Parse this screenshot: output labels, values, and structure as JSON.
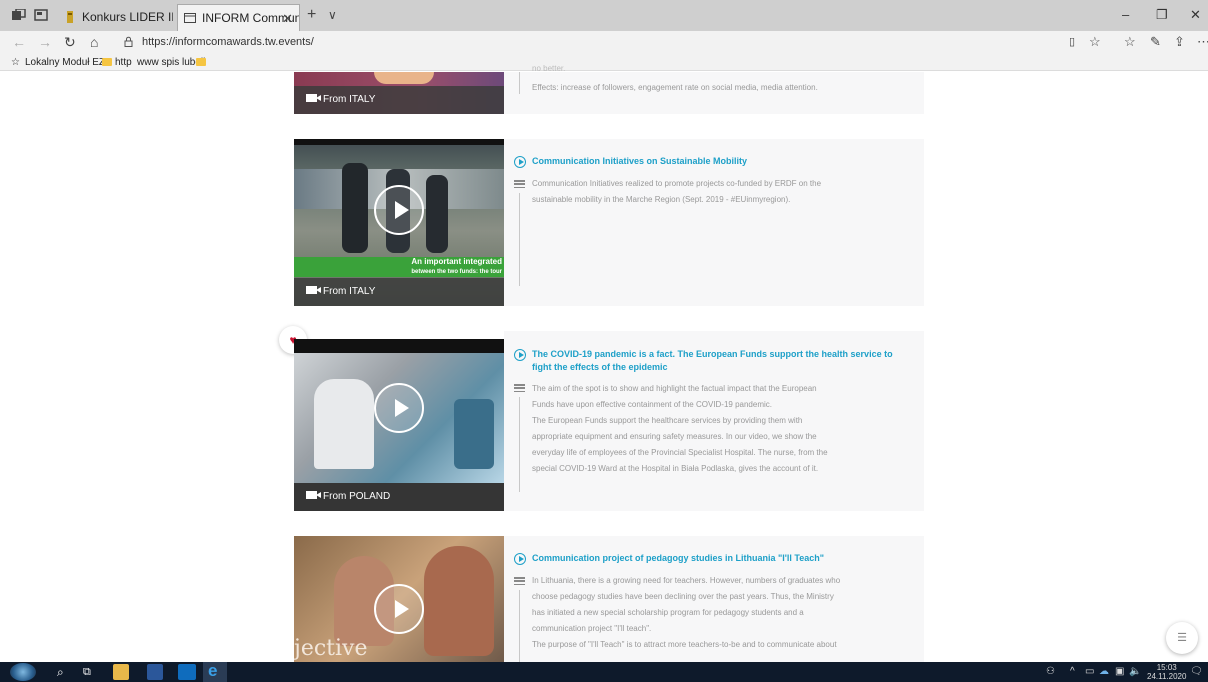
{
  "browser": {
    "tabs": [
      {
        "label": "Konkurs LIDER INNOWACJI",
        "active": false
      },
      {
        "label": "INFORM Communicatio",
        "active": true
      }
    ],
    "new_tab": "+",
    "tab_list": "∨",
    "url": "https://informcomawards.tw.events/",
    "bookmarks": [
      "Lokalny Moduł EZD",
      "http",
      "www spis lubeli"
    ]
  },
  "cards": [
    {
      "from": "From ITALY",
      "desc": [
        "no better.",
        "Effects: increase of followers, engagement rate on social media, media attention."
      ]
    },
    {
      "title": "Communication Initiatives on Sustainable Mobility",
      "from": "From ITALY",
      "overlay_text": [
        "An important integrated",
        "between the two funds: the tour"
      ],
      "desc": [
        "Communication Initiatives realized to promote projects co-funded by ERDF on the",
        "sustainable mobility in the Marche Region (Sept. 2019 - #EUinmyregion)."
      ]
    },
    {
      "title_lines": [
        "The COVID-19 pandemic is a fact. The European Funds support the health service to",
        "fight the effects of the epidemic"
      ],
      "from": "From POLAND",
      "desc": [
        "The aim of the spot is to show and highlight the factual impact that the European",
        "Funds have upon effective containment of the COVID-19 pandemic.",
        "The European Funds support the healthcare services by providing them with",
        "appropriate equipment and ensuring safety measures. In our video, we show the",
        "everyday life of employees of the Provincial Specialist Hospital. The nurse, from the",
        "special COVID-19 Ward at the Hospital in Biała Podlaska, gives the account of it."
      ]
    },
    {
      "title": "Communication project of pedagogy studies in Lithuania \"I'll Teach\"",
      "overlay_text": "jective",
      "desc": [
        "In Lithuania, there is a growing need for teachers. However, numbers of graduates who",
        "choose pedagogy studies have been declining over the past years. Thus, the Ministry",
        "has initiated a new special scholarship program for pedagogy students and a",
        "communication project \"I'll teach\".",
        "The purpose of \"I'll Teach\" is to attract more teachers-to-be and to communicate about"
      ]
    }
  ],
  "taskbar": {
    "time": "15:03",
    "date": "24.11.2020"
  },
  "colors": {
    "accent": "#1ea0c8",
    "heart": "#c8102e",
    "taskbar": "#0e1a2b"
  }
}
